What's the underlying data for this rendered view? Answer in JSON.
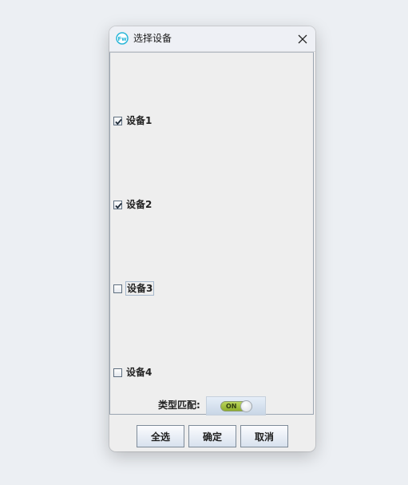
{
  "window": {
    "title": "选择设备",
    "icon_text": "Fw",
    "icon_color": "#29b6d8"
  },
  "devices": [
    {
      "label": "设备1",
      "checked": true
    },
    {
      "label": "设备2",
      "checked": true
    },
    {
      "label": "设备3",
      "checked": false
    },
    {
      "label": "设备4",
      "checked": false
    }
  ],
  "type_match": {
    "label": "类型匹配:",
    "toggle_text": "ON",
    "on": true
  },
  "buttons": {
    "select_all": "全选",
    "confirm": "确定",
    "cancel": "取消"
  }
}
